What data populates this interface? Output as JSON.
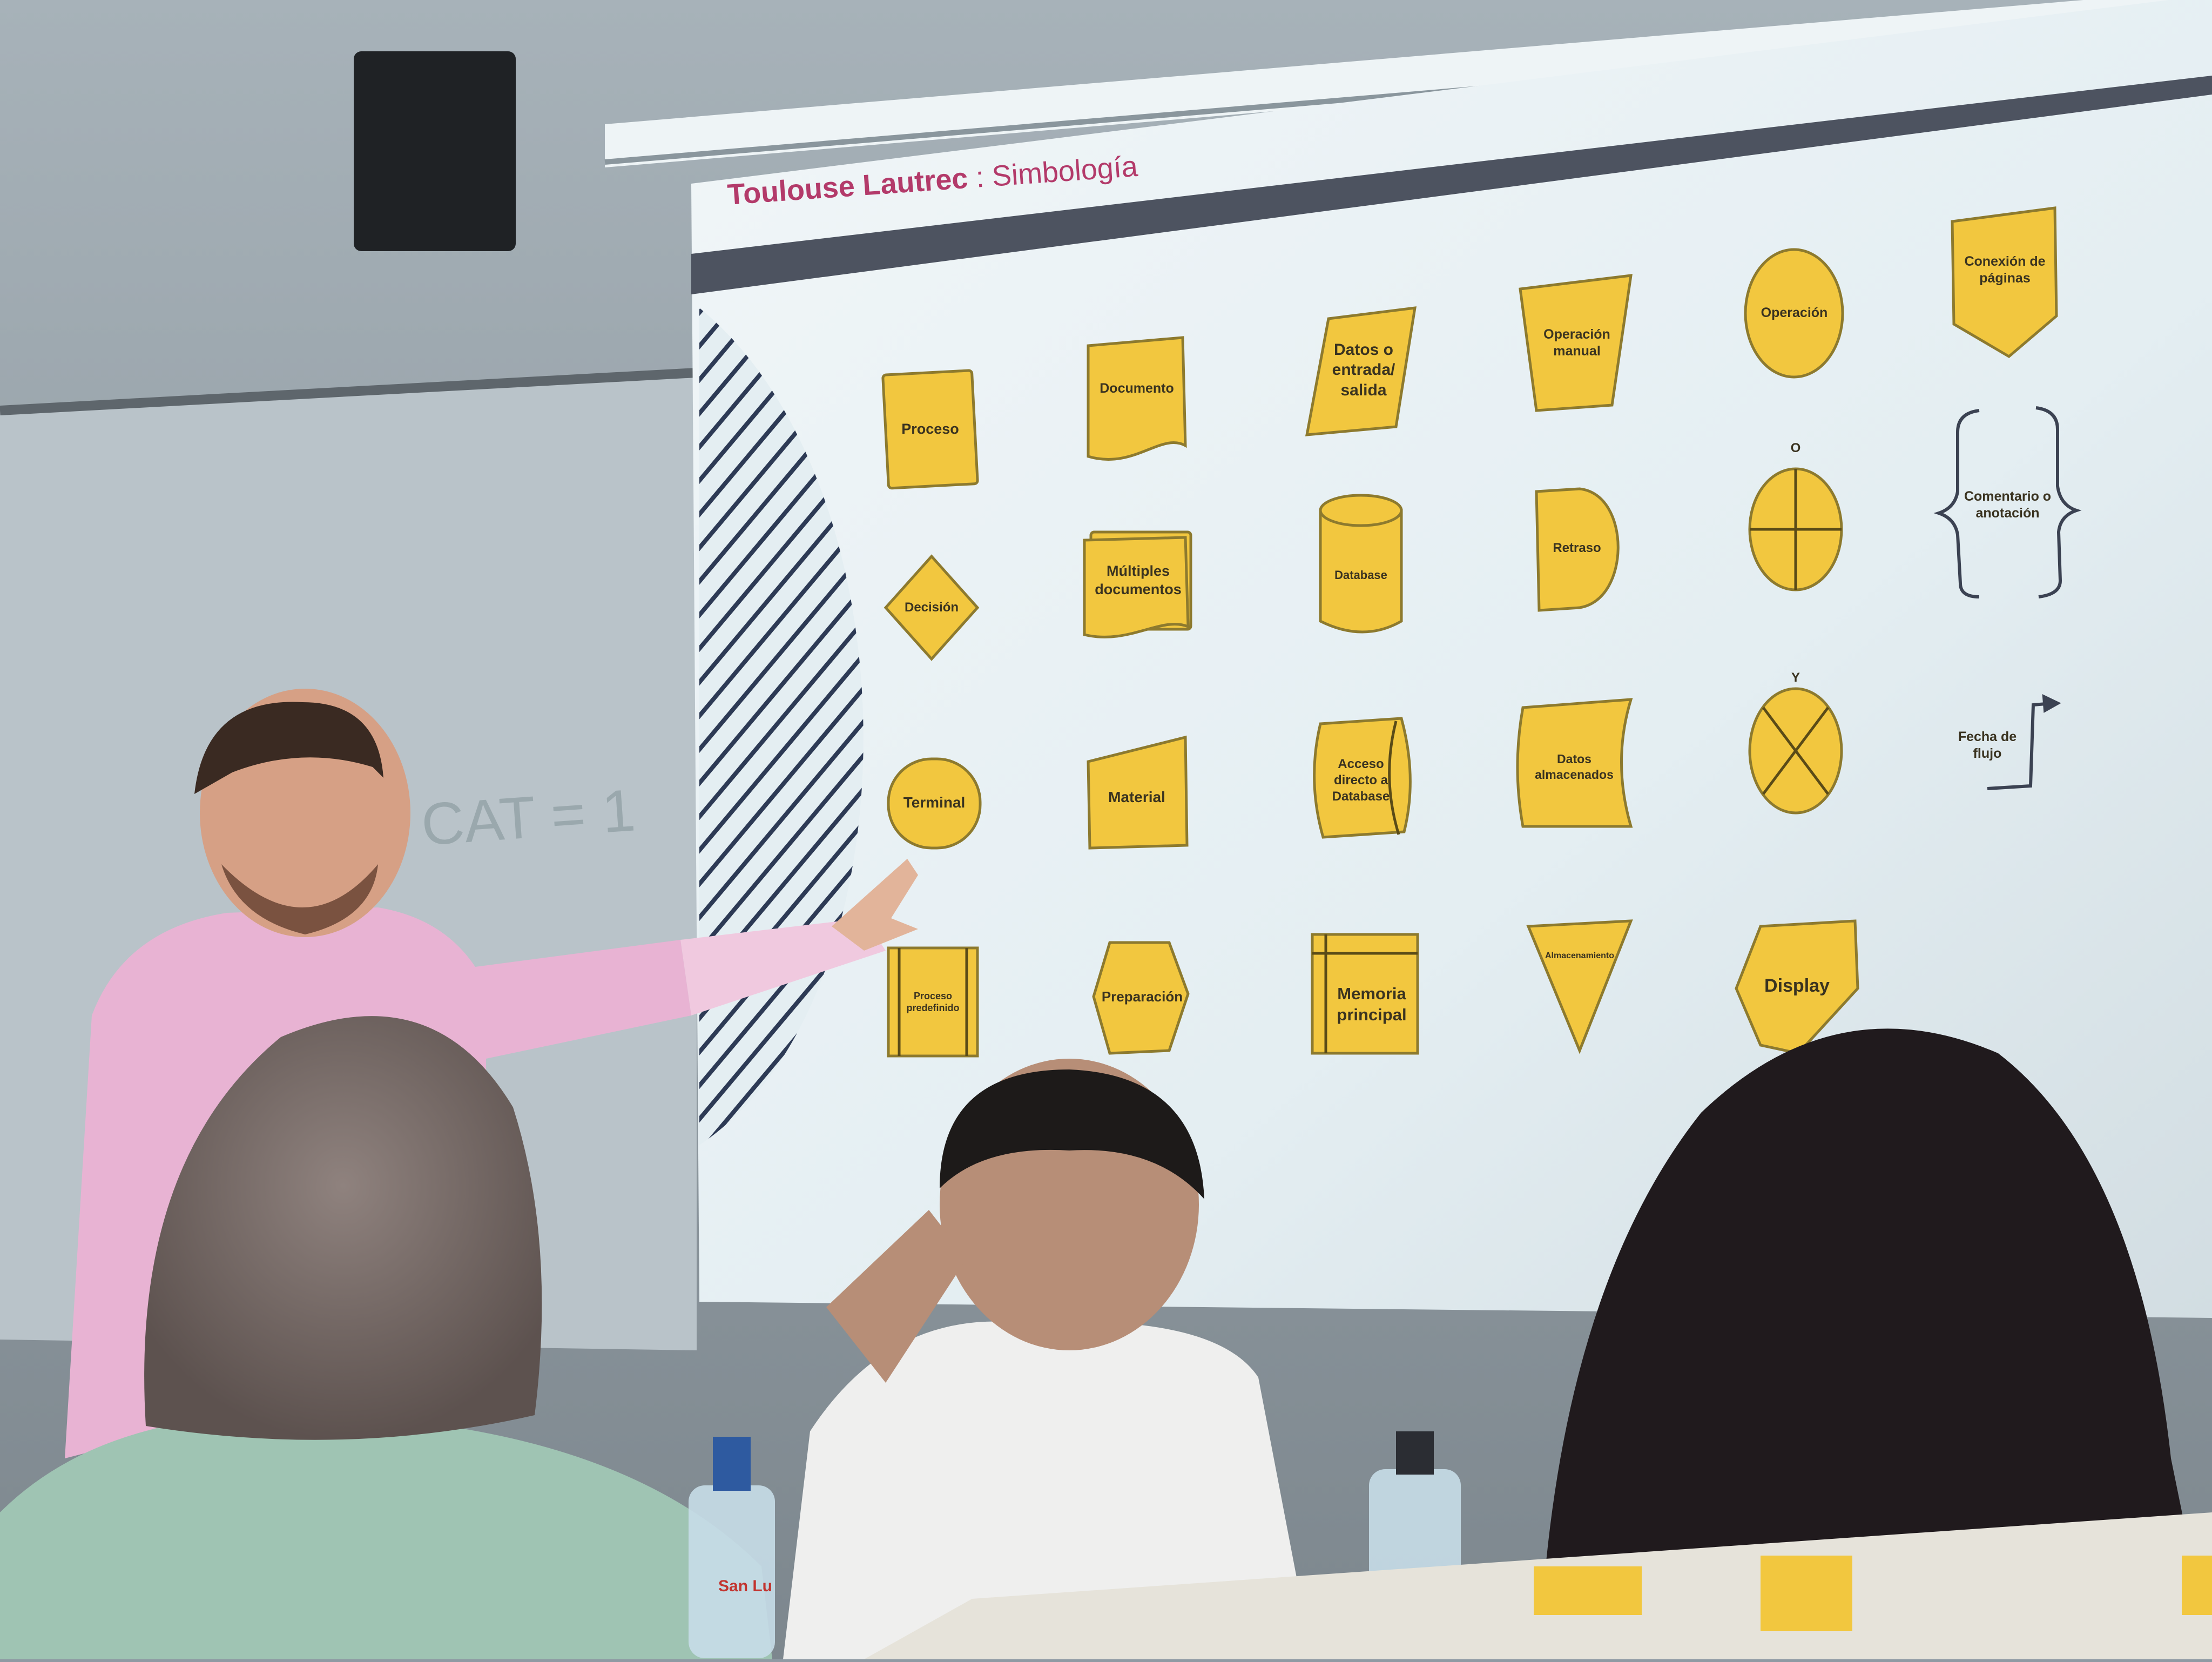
{
  "slide": {
    "title_bold": "Toulouse Lautrec",
    "title_sep": " : ",
    "title_rest": "Simbología"
  },
  "symbols": [
    {
      "key": "proceso",
      "label": "Proceso"
    },
    {
      "key": "documento",
      "label": "Documento"
    },
    {
      "key": "datos_entrada",
      "label": "Datos o entrada/ salida"
    },
    {
      "key": "operacion_manual",
      "label": "Operación manual"
    },
    {
      "key": "operacion",
      "label": "Operación"
    },
    {
      "key": "conexion_paginas",
      "label": "Conexión de páginas"
    },
    {
      "key": "decision",
      "label": "Decisión"
    },
    {
      "key": "multiples_documentos",
      "label": "Múltiples documentos"
    },
    {
      "key": "database",
      "label": "Database"
    },
    {
      "key": "retraso",
      "label": "Retraso"
    },
    {
      "key": "o_symbol",
      "label": "O"
    },
    {
      "key": "comentario",
      "label": "Comentario o anotación"
    },
    {
      "key": "terminal",
      "label": "Terminal"
    },
    {
      "key": "material",
      "label": "Material"
    },
    {
      "key": "acceso_directo",
      "label": "Acceso directo a Database"
    },
    {
      "key": "datos_almacenados",
      "label": "Datos almacenados"
    },
    {
      "key": "y_symbol",
      "label": "Y"
    },
    {
      "key": "flecha_flujo",
      "label": "Fecha de flujo"
    },
    {
      "key": "proceso_predefinido",
      "label": "Proceso predefinido"
    },
    {
      "key": "preparacion",
      "label": "Preparación"
    },
    {
      "key": "memoria_principal",
      "label": "Memoria principal"
    },
    {
      "key": "almacenamiento",
      "label": "Almacenamiento"
    },
    {
      "key": "display",
      "label": "Display"
    }
  ],
  "whiteboard": {
    "formula": "CAT = 1"
  },
  "bottle": {
    "brand": "San Lu"
  },
  "colors": {
    "symbol_fill": "#f2c73f",
    "title": "#b33a6a",
    "screen": "#e3edf2",
    "hoodie": "#e8b3d3"
  }
}
